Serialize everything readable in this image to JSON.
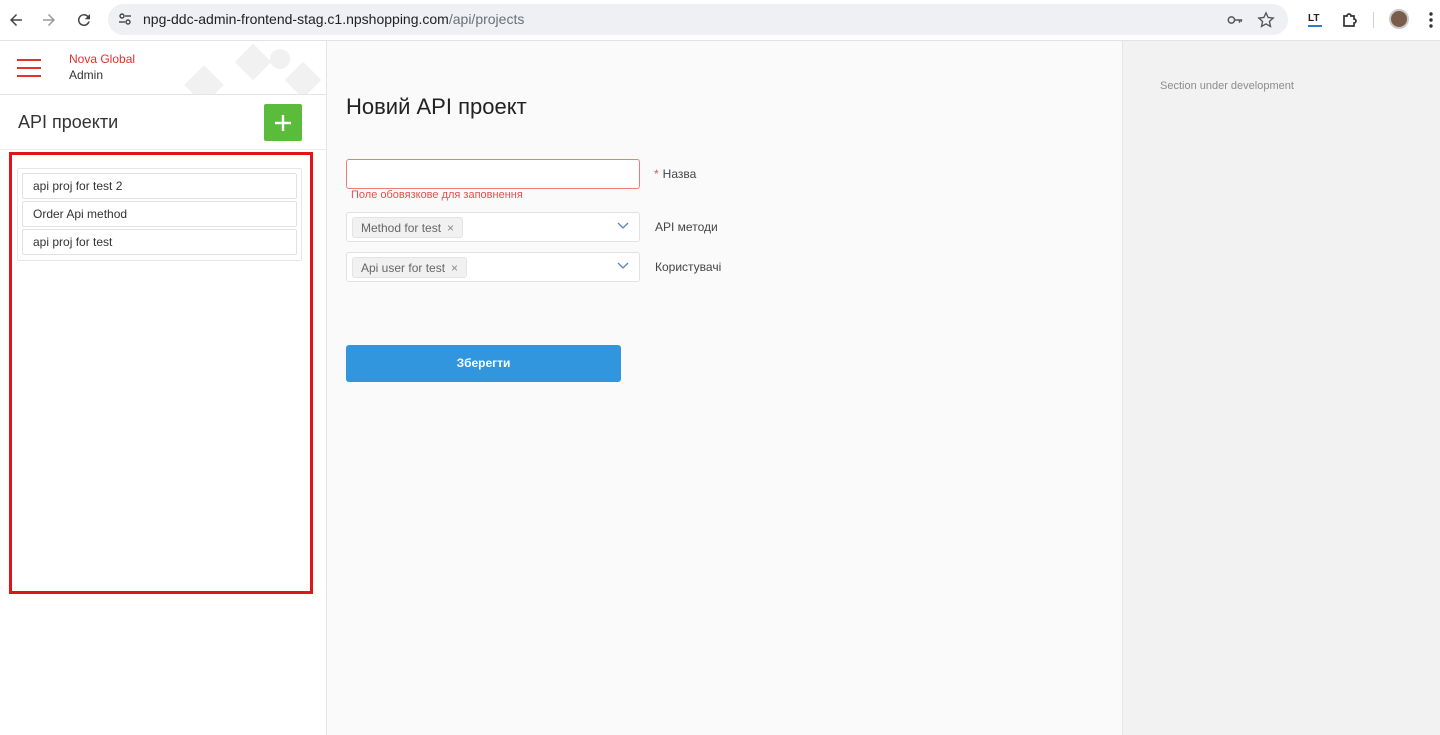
{
  "browser": {
    "url_host": "npg-ddc-admin-frontend-stag.c1.npshopping.com",
    "url_path": "/api/projects",
    "extension_label": "LT"
  },
  "brand": {
    "line1": "Nova Global",
    "line2": "Admin",
    "accent_color": "#e2322a"
  },
  "sidebar": {
    "title": "API проекти",
    "add_icon": "plus-icon",
    "projects": [
      {
        "label": "api proj for test 2"
      },
      {
        "label": "Order Api method"
      },
      {
        "label": "api proj for test"
      }
    ]
  },
  "form": {
    "title": "Новий API проект",
    "name_field": {
      "value": "",
      "required_mark": "*",
      "label": "Назва",
      "error": "Поле обовязкове для заповнення"
    },
    "methods_field": {
      "label": "API методи",
      "tag": "Method for test",
      "tag_remove": "×"
    },
    "users_field": {
      "label": "Користувачі",
      "tag": "Api user for test",
      "tag_remove": "×"
    },
    "save_label": "Зберегти",
    "save_color": "#3296df"
  },
  "right_panel": {
    "text": "Section under development"
  }
}
